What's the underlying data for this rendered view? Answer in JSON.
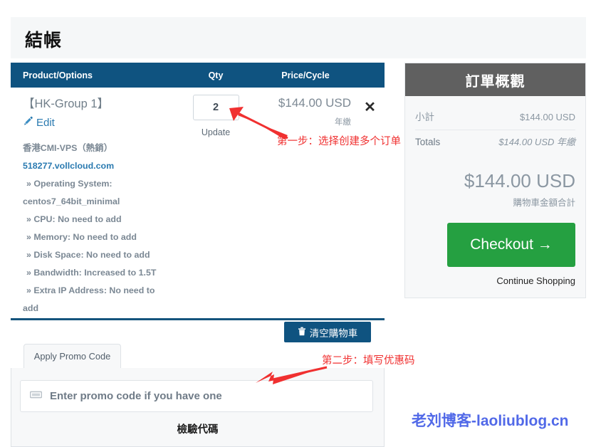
{
  "page": {
    "title": "結帳"
  },
  "cart_table": {
    "columns": [
      "Product/Options",
      "Qty",
      "Price/Cycle"
    ],
    "header_bg": "#0f5380",
    "rows": [
      {
        "product_name": "【HK-Group 1】",
        "edit_label": "Edit",
        "edit_icon": "pencil-icon",
        "qty_value": "2",
        "qty_update_label": "Update",
        "price": "$144.00 USD",
        "cycle": "年繳",
        "remove_icon": "close-x-icon",
        "options": [
          {
            "text": "香港CMI-VPS（熱銷）",
            "style": "title"
          },
          {
            "text": "518277.vollcloud.com",
            "style": "domain"
          },
          {
            "text": "» Operating System:",
            "style": "opt"
          },
          {
            "text": "centos7_64bit_minimal",
            "style": "cont"
          },
          {
            "text": "» CPU: No need to add",
            "style": "opt"
          },
          {
            "text": "» Memory: No need to add",
            "style": "opt"
          },
          {
            "text": "» Disk Space: No need to add",
            "style": "opt"
          },
          {
            "text": "» Bandwidth: Increased to 1.5T",
            "style": "opt"
          },
          {
            "text": "» Extra IP Address: No need to",
            "style": "opt"
          },
          {
            "text": "add",
            "style": "cont"
          }
        ]
      }
    ]
  },
  "cart_actions": {
    "clear_cart_label": "清空購物車",
    "clear_cart_icon": "trash-icon",
    "clear_cart_bg": "#0f5380"
  },
  "promo": {
    "tab_label": "Apply Promo Code",
    "input_placeholder": "Enter promo code if you have one",
    "input_value": "",
    "input_icon": "ticket-icon",
    "validate_label": "檢驗代碼"
  },
  "summary": {
    "heading": "訂單概觀",
    "heading_bg": "#606060",
    "rows": [
      {
        "label": "小計",
        "value": "$144.00 USD"
      },
      {
        "label": "Totals",
        "value": "$144.00 USD 年繳"
      }
    ],
    "grand_total": "$144.00 USD",
    "grand_total_caption": "購物車金額合計",
    "checkout_label": "Checkout →",
    "checkout_bg": "#25a041",
    "continue_shopping_label": "Continue Shopping"
  },
  "annotations": [
    {
      "text": "第一步：选择创建多个订单",
      "color": "#f03030"
    },
    {
      "text": "第二步：填写优惠码",
      "color": "#f03030"
    }
  ],
  "watermark": {
    "text": "老刘博客-laoliublog.cn",
    "color": "#5169e8"
  }
}
